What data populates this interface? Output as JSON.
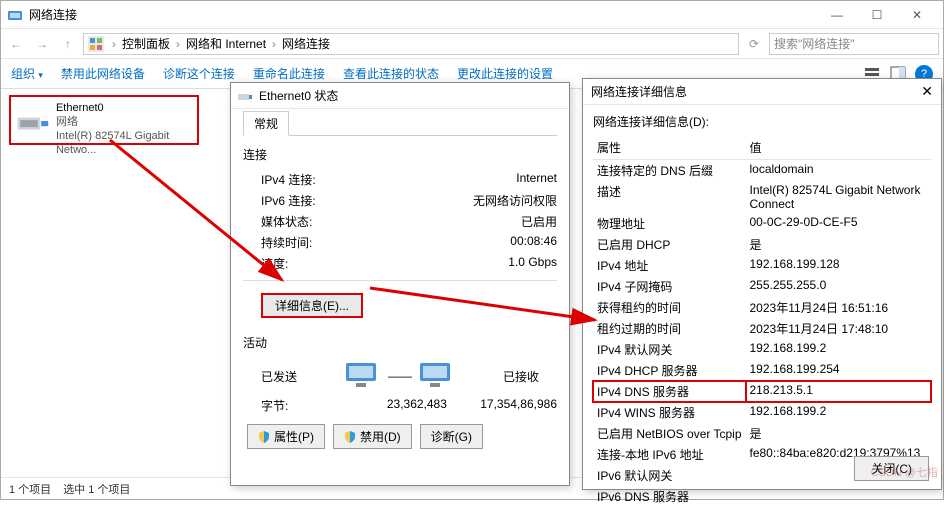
{
  "window": {
    "title": "网络连接",
    "min": "—",
    "max": "☐",
    "close": "✕",
    "back": "←",
    "forward": "→",
    "up": "↑",
    "breadcrumb": [
      "控制面板",
      "网络和 Internet",
      "网络连接"
    ],
    "search_placeholder": "搜索\"网络连接\"",
    "refresh_icon": "⟳"
  },
  "commandbar": {
    "organize": "组织",
    "caret": "▾",
    "items": [
      "禁用此网络设备",
      "诊断这个连接",
      "重命名此连接",
      "查看此连接的状态",
      "更改此连接的设置"
    ]
  },
  "adapter": {
    "name": "Ethernet0",
    "network": "网络",
    "device": "Intel(R) 82574L Gigabit Netwo..."
  },
  "statusbar": {
    "count": "1 个项目",
    "selected": "选中 1 个项目"
  },
  "status_dialog": {
    "title": "Ethernet0 状态",
    "tab": "常规",
    "group_conn": "连接",
    "rows_conn": {
      "ipv4_label": "IPv4 连接:",
      "ipv4_value": "Internet",
      "ipv6_label": "IPv6 连接:",
      "ipv6_value": "无网络访问权限",
      "media_label": "媒体状态:",
      "media_value": "已启用",
      "duration_label": "持续时间:",
      "duration_value": "00:08:46",
      "speed_label": "速度:",
      "speed_value": "1.0 Gbps"
    },
    "details_btn": "详细信息(E)...",
    "group_act": "活动",
    "sent_label": "已发送",
    "recv_label": "已接收",
    "dash": "——",
    "bytes_label": "字节:",
    "sent_bytes": "23,362,483",
    "recv_bytes": "17,354,86,986",
    "btn_props": "属性(P)",
    "btn_disable": "禁用(D)",
    "btn_diag": "诊断(G)"
  },
  "details_dialog": {
    "title": "网络连接详细信息",
    "caption": "网络连接详细信息(D):",
    "th_prop": "属性",
    "th_val": "值",
    "rows": [
      {
        "p": "连接特定的 DNS 后缀",
        "v": "localdomain"
      },
      {
        "p": "描述",
        "v": "Intel(R) 82574L Gigabit Network Connect"
      },
      {
        "p": "物理地址",
        "v": "00-0C-29-0D-CE-F5"
      },
      {
        "p": "已启用 DHCP",
        "v": "是"
      },
      {
        "p": "IPv4 地址",
        "v": "192.168.199.128"
      },
      {
        "p": "IPv4 子网掩码",
        "v": "255.255.255.0"
      },
      {
        "p": "获得租约的时间",
        "v": "2023年11月24日 16:51:16"
      },
      {
        "p": "租约过期的时间",
        "v": "2023年11月24日 17:48:10"
      },
      {
        "p": "IPv4 默认网关",
        "v": "192.168.199.2"
      },
      {
        "p": "IPv4 DHCP 服务器",
        "v": "192.168.199.254"
      },
      {
        "p": "IPv4 DNS 服务器",
        "v": "218.213.5.1",
        "hl": true
      },
      {
        "p": "IPv4 WINS 服务器",
        "v": "192.168.199.2"
      },
      {
        "p": "已启用 NetBIOS over Tcpip",
        "v": "是"
      },
      {
        "p": "连接-本地 IPv6 地址",
        "v": "fe80::84ba:e820:d219:3797%13"
      },
      {
        "p": "IPv6 默认网关",
        "v": ""
      },
      {
        "p": "IPv6 DNS 服务器",
        "v": ""
      }
    ],
    "close_btn": "关闭(C)"
  },
  "watermark": "CSDN @七指"
}
